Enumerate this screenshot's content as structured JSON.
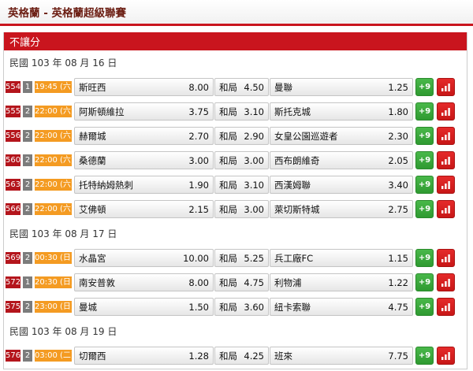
{
  "header": {
    "title": "英格蘭 - 英格蘭超級聯賽"
  },
  "market": {
    "label": "不讓分"
  },
  "labels": {
    "more_prefix": "+"
  },
  "colors": {
    "brand_red": "#c9151e",
    "time_orange": "#f49b22",
    "more_green": "#3aa83c",
    "stats_red": "#d61e1e"
  },
  "groups": [
    {
      "date": "民國 103 年 08 月 16 日",
      "matches": [
        {
          "id": "554",
          "num": "1",
          "time": "19:45 (六)",
          "home": "斯旺西",
          "home_odds": "8.00",
          "draw": "和局",
          "draw_odds": "4.50",
          "away": "曼聯",
          "away_odds": "1.25",
          "more": 9
        },
        {
          "id": "555",
          "num": "2",
          "time": "22:00 (六)",
          "home": "阿斯頓維拉",
          "home_odds": "3.75",
          "draw": "和局",
          "draw_odds": "3.10",
          "away": "斯托克城",
          "away_odds": "1.80",
          "more": 9
        },
        {
          "id": "556",
          "num": "2",
          "time": "22:00 (六)",
          "home": "赫爾城",
          "home_odds": "2.70",
          "draw": "和局",
          "draw_odds": "2.90",
          "away": "女皇公園巡遊者",
          "away_odds": "2.30",
          "more": 9
        },
        {
          "id": "560",
          "num": "2",
          "time": "22:00 (六)",
          "home": "桑德蘭",
          "home_odds": "3.00",
          "draw": "和局",
          "draw_odds": "3.00",
          "away": "西布朗維奇",
          "away_odds": "2.05",
          "more": 9
        },
        {
          "id": "563",
          "num": "2",
          "time": "22:00 (六)",
          "home": "托特納姆熱刺",
          "home_odds": "1.90",
          "draw": "和局",
          "draw_odds": "3.10",
          "away": "西漢姆聯",
          "away_odds": "3.40",
          "more": 9
        },
        {
          "id": "566",
          "num": "2",
          "time": "22:00 (六)",
          "home": "艾佛頓",
          "home_odds": "2.15",
          "draw": "和局",
          "draw_odds": "3.00",
          "away": "萊切斯特城",
          "away_odds": "2.75",
          "more": 9
        }
      ]
    },
    {
      "date": "民國 103 年 08 月 17 日",
      "matches": [
        {
          "id": "569",
          "num": "2",
          "time": "00:30 (日)",
          "home": "水晶宮",
          "home_odds": "10.00",
          "draw": "和局",
          "draw_odds": "5.25",
          "away": "兵工廠FC",
          "away_odds": "1.15",
          "more": 9
        },
        {
          "id": "572",
          "num": "1",
          "time": "20:30 (日)",
          "home": "南安普敦",
          "home_odds": "8.00",
          "draw": "和局",
          "draw_odds": "4.75",
          "away": "利物浦",
          "away_odds": "1.22",
          "more": 9
        },
        {
          "id": "575",
          "num": "2",
          "time": "23:00 (日)",
          "home": "曼城",
          "home_odds": "1.50",
          "draw": "和局",
          "draw_odds": "3.60",
          "away": "紐卡索聯",
          "away_odds": "4.75",
          "more": 9
        }
      ]
    },
    {
      "date": "民國 103 年 08 月 19 日",
      "matches": [
        {
          "id": "576",
          "num": "2",
          "time": "03:00 (二)",
          "home": "切爾西",
          "home_odds": "1.28",
          "draw": "和局",
          "draw_odds": "4.25",
          "away": "班來",
          "away_odds": "7.75",
          "more": 9
        }
      ]
    }
  ]
}
